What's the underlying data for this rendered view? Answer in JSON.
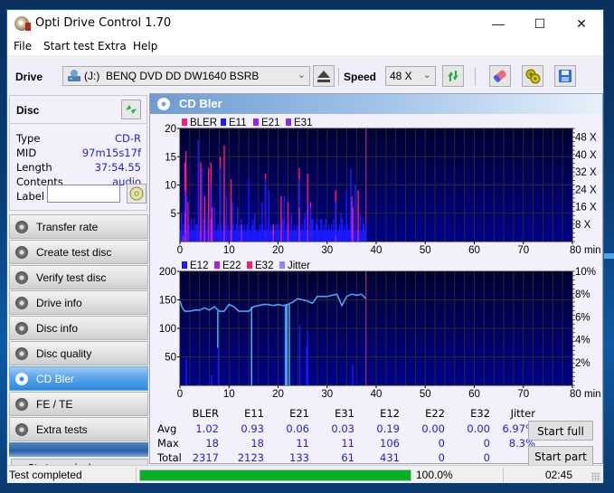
{
  "window": {
    "title": "Opti Drive Control 1.70",
    "controls": {
      "minimize": "—",
      "maximize": "☐",
      "close": "✕"
    }
  },
  "menu": [
    "File",
    "Start test",
    "Extra",
    "Help"
  ],
  "toolbar": {
    "drive_label": "Drive",
    "drive_letter": "(J:)",
    "drive_value": "BENQ DVD DD DW1640 BSRB",
    "speed_label": "Speed",
    "speed_value": "48 X",
    "icons": [
      "drive-icon",
      "eject-icon",
      "refresh-icon",
      "erase-icon",
      "settings-icon",
      "save-icon"
    ]
  },
  "disc": {
    "title": "Disc",
    "rows": [
      {
        "key": "Type",
        "value": "CD-R"
      },
      {
        "key": "MID",
        "value": "97m15s17f"
      },
      {
        "key": "Length",
        "value": "37:54.55"
      },
      {
        "key": "Contents",
        "value": "audio"
      }
    ],
    "label_key": "Label",
    "label_value": ""
  },
  "nav": [
    {
      "label": "Transfer rate",
      "active": false
    },
    {
      "label": "Create test disc",
      "active": false
    },
    {
      "label": "Verify test disc",
      "active": false
    },
    {
      "label": "Drive info",
      "active": false
    },
    {
      "label": "Disc info",
      "active": false
    },
    {
      "label": "Disc quality",
      "active": false
    },
    {
      "label": "CD Bler",
      "active": true
    },
    {
      "label": "FE / TE",
      "active": false
    },
    {
      "label": "Extra tests",
      "active": false
    }
  ],
  "status_window_label": "Status window > >",
  "panel": {
    "title": "CD Bler"
  },
  "colors": {
    "BLER": "#ff1a78",
    "E11": "#1a1aff",
    "E21": "#a020f0",
    "E31": "#8a2be2",
    "E12": "#1a1aff",
    "E22": "#a020f0",
    "E32": "#ff1a78",
    "Jitter": "#8888ff",
    "jitter_line": "#4aa3f0",
    "progress": "#06b025"
  },
  "chart_data": [
    {
      "type": "bar",
      "title": "CD Bler (upper)",
      "legend": [
        "BLER",
        "E11",
        "E21",
        "E31"
      ],
      "legend_position": "top-left",
      "xlabel": "min",
      "x_ticks": [
        "0",
        "10",
        "20",
        "30",
        "40",
        "50",
        "60",
        "70",
        "80 min"
      ],
      "y_ticks": [
        "5",
        "10",
        "15",
        "20"
      ],
      "y2_ticks": [
        "8 X",
        "16 X",
        "24 X",
        "32 X",
        "40 X",
        "48 X"
      ],
      "xlim": [
        0,
        80
      ],
      "ylim": [
        0,
        20
      ],
      "y2lim": [
        0,
        52
      ],
      "grid": true,
      "end_marker_min": 37.9,
      "series": [
        {
          "name": "BLER",
          "x": [
            0.9,
            1.1,
            1.5,
            3.6,
            4.1,
            4.9,
            5.7,
            6.2,
            6.4,
            8.1,
            8.9,
            10.3,
            17.3,
            18.9,
            20.5,
            21.9,
            24.2,
            25.9,
            26.5,
            31.6,
            34.9,
            35.1,
            36.2
          ],
          "y": [
            14,
            16,
            7,
            14,
            14,
            8,
            13,
            14,
            6,
            15,
            17,
            11,
            12,
            3,
            8,
            7,
            13,
            12,
            7,
            9,
            8,
            6,
            9
          ]
        },
        {
          "name": "E11",
          "x": [
            0.2,
            0.9,
            1.3,
            2.2,
            3.1,
            3.6,
            4.4,
            5.5,
            6.1,
            7.0,
            8.1,
            9.4,
            10.6,
            11.6,
            13.9,
            15.1,
            16.6,
            17.3,
            18.0,
            19.7,
            21.1,
            22.6,
            24.2,
            25.4,
            26.5,
            27.8,
            29.6,
            31.6,
            32.7,
            33.8,
            34.7,
            35.6,
            36.6,
            37.4
          ],
          "y": [
            5,
            9,
            8,
            4,
            3,
            18,
            13,
            5,
            10,
            6,
            13,
            8,
            7,
            6,
            11,
            5,
            7,
            11,
            9,
            3,
            8,
            5,
            11,
            5,
            6,
            4,
            4,
            7,
            5,
            9,
            13,
            10,
            5,
            3
          ]
        },
        {
          "name": "E21",
          "x": [
            0.9,
            6.2,
            8.9,
            12.4,
            24.2,
            25.9,
            34.9
          ],
          "y": [
            5,
            4,
            2,
            3,
            6,
            7,
            7
          ]
        },
        {
          "name": "E31",
          "x": [
            0.5,
            1.1,
            18.9,
            21.9,
            24.2,
            25.9,
            31.6,
            36.2
          ],
          "y": [
            1,
            2,
            1,
            1,
            1,
            1,
            1,
            1
          ]
        }
      ],
      "baseline_E11_approx": 2
    },
    {
      "type": "line",
      "title": "CD Bler (lower)",
      "legend": [
        "E12",
        "E22",
        "E32",
        "Jitter"
      ],
      "legend_position": "top-left",
      "xlabel": "min",
      "x_ticks": [
        "0",
        "10",
        "20",
        "30",
        "40",
        "50",
        "60",
        "70",
        "80 min"
      ],
      "y_ticks": [
        "50",
        "100",
        "150",
        "200"
      ],
      "y2_ticks": [
        "2%",
        "4%",
        "6%",
        "8%",
        "10%"
      ],
      "xlim": [
        0,
        80
      ],
      "ylim": [
        0,
        200
      ],
      "y2lim": [
        0,
        10
      ],
      "grid": true,
      "end_marker_min": 37.9,
      "series": [
        {
          "name": "E12",
          "x": [
            1.2,
            3.8,
            6.3,
            7.7,
            24.3,
            25.7,
            25.9,
            35.1
          ],
          "y": [
            48,
            3,
            18,
            65,
            106,
            68,
            95,
            37
          ]
        },
        {
          "name": "E22",
          "x": [],
          "y": []
        },
        {
          "name": "E32",
          "x": [],
          "y": []
        },
        {
          "name": "Jitter",
          "unit": "%",
          "x": [
            0,
            0.5,
            1,
            2,
            3,
            4,
            5,
            6,
            7,
            8,
            9,
            10,
            11,
            12,
            13,
            14,
            15,
            16,
            17,
            18,
            19,
            20,
            21,
            22,
            23,
            24,
            25,
            26,
            27,
            28,
            29,
            30,
            31,
            32,
            33,
            34,
            35,
            36,
            37,
            37.9
          ],
          "y": [
            7.4,
            6.8,
            6.5,
            6.5,
            6.6,
            6.6,
            6.8,
            6.6,
            6.9,
            6.5,
            6.5,
            7.1,
            6.9,
            6.5,
            6.5,
            6.5,
            6.9,
            7.0,
            7.1,
            7.1,
            7.0,
            7.1,
            7.0,
            7.1,
            7.3,
            7.6,
            7.5,
            7.4,
            7.2,
            7.8,
            7.8,
            7.8,
            7.9,
            8.0,
            7.0,
            7.8,
            8.0,
            7.9,
            8.0,
            7.6
          ],
          "dropouts": [
            {
              "x": 7.7,
              "y": 3.3
            },
            {
              "x": 14.6,
              "y": 0
            },
            {
              "x": 21.5,
              "y": 0
            },
            {
              "x": 21.8,
              "y": 0
            },
            {
              "x": 22.3,
              "y": 0
            }
          ]
        }
      ]
    }
  ],
  "stats": {
    "columns": [
      "BLER",
      "E11",
      "E21",
      "E31",
      "E12",
      "E22",
      "E32",
      "Jitter"
    ],
    "rows": [
      {
        "label": "Avg",
        "values": [
          "1.02",
          "0.93",
          "0.06",
          "0.03",
          "0.19",
          "0.00",
          "0.00",
          "6.97%"
        ]
      },
      {
        "label": "Max",
        "values": [
          "18",
          "18",
          "11",
          "11",
          "106",
          "0",
          "0",
          "8.3%"
        ]
      },
      {
        "label": "Total",
        "values": [
          "2317",
          "2123",
          "133",
          "61",
          "431",
          "0",
          "0",
          ""
        ]
      }
    ]
  },
  "buttons": {
    "start_full": "Start full",
    "start_part": "Start part"
  },
  "statusbar": {
    "text": "Test completed",
    "progress": 1.0,
    "progress_text": "100.0%",
    "time": "02:45"
  }
}
